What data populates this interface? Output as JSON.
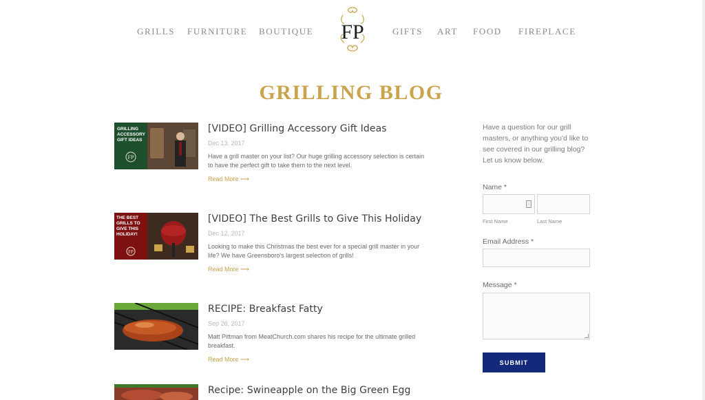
{
  "nav": {
    "left": [
      "GRILLS",
      "FURNITURE",
      "BOUTIQUE"
    ],
    "right": [
      "GIFTS",
      "ART",
      "FOOD",
      "FIREPLACE"
    ],
    "logo_text": "FP"
  },
  "page_title": "GRILLING BLOG",
  "posts": [
    {
      "title": "[VIDEO] Grilling Accessory Gift Ideas",
      "date": "Dec 13, 2017",
      "excerpt": "Have a grill master on your list? Our huge grilling accessory selection is certain to have the perfect gift to take them to the next level.",
      "read_more": "Read More ⟶",
      "thumb_text": "GRILLING ACCESSORY GIFT IDEAS"
    },
    {
      "title": "[VIDEO] The Best Grills to Give This Holiday",
      "date": "Dec 12, 2017",
      "excerpt": "Looking to make this Christmas the best ever for a special grill master in your life? We have Greensboro's largest selection of grills!",
      "read_more": "Read More ⟶",
      "thumb_text": "THE BEST GRILLS TO GIVE THIS HOLIDAY!"
    },
    {
      "title": "RECIPE: Breakfast Fatty",
      "date": "Sep 26, 2017",
      "excerpt": "Matt Pittman from MeatChurch.com shares his recipe for the ultimate grilled breakfast.",
      "read_more": "Read More ⟶"
    },
    {
      "title": "Recipe: Swineapple on the Big Green Egg"
    }
  ],
  "form": {
    "intro": "Have a question for our grill masters, or anything you'd like to see covered in our grilling blog? Let us know below.",
    "name_label": "Name *",
    "first_name_label": "First Name",
    "last_name_label": "Last Name",
    "email_label": "Email Address *",
    "message_label": "Message *",
    "submit_label": "SUBMIT"
  },
  "colors": {
    "gold": "#c9a44d",
    "navy": "#13297a"
  }
}
